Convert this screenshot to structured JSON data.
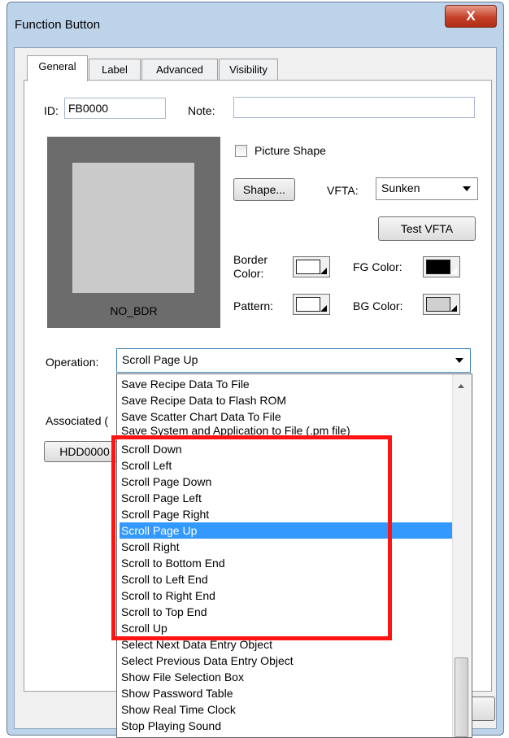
{
  "window": {
    "title": "Function Button",
    "close_label": "X"
  },
  "tabs": [
    {
      "label": "General",
      "active": true
    },
    {
      "label": "Label",
      "active": false
    },
    {
      "label": "Advanced",
      "active": false
    },
    {
      "label": "Visibility",
      "active": false
    }
  ],
  "general": {
    "id_label": "ID:",
    "id_value": "FB0000",
    "note_label": "Note:",
    "note_value": "",
    "preview_label": "NO_BDR",
    "picture_shape_label": "Picture Shape",
    "picture_shape_checked": false,
    "shape_button": "Shape...",
    "vfta_label": "VFTA:",
    "vfta_value": "Sunken",
    "test_vfta_button": "Test VFTA",
    "border_color_label": "Border\nColor:",
    "fg_color_label": "FG Color:",
    "pattern_label": "Pattern:",
    "bg_color_label": "BG Color:",
    "colors": {
      "border": "#ffffff",
      "fg": "#000000",
      "pattern": "#ffffff",
      "bg": "#d0d0d0"
    },
    "operation_label": "Operation:",
    "operation_value": "Scroll Page Up",
    "associated_label": "Associated (",
    "associated_button": "HDD0000"
  },
  "operation_options": [
    "Save Recipe Data To File",
    "Save Recipe Data to Flash ROM",
    "Save Scatter Chart Data To File",
    "Save System and Application to File (.pm file)",
    "Scroll Down",
    "Scroll Left",
    "Scroll Page Down",
    "Scroll Page Left",
    "Scroll Page Right",
    "Scroll Page Up",
    "Scroll Right",
    "Scroll to Bottom End",
    "Scroll to Left End",
    "Scroll to Right End",
    "Scroll to Top End",
    "Scroll Up",
    "Select Next Data Entry Object",
    "Select Previous Data Entry Object",
    "Show File Selection Box",
    "Show Password Table",
    "Show Real Time Clock",
    "Stop Playing Sound"
  ],
  "selected_option": "Scroll Page Up",
  "accent_color": "#3399ff",
  "highlight_color": "#ff1414"
}
